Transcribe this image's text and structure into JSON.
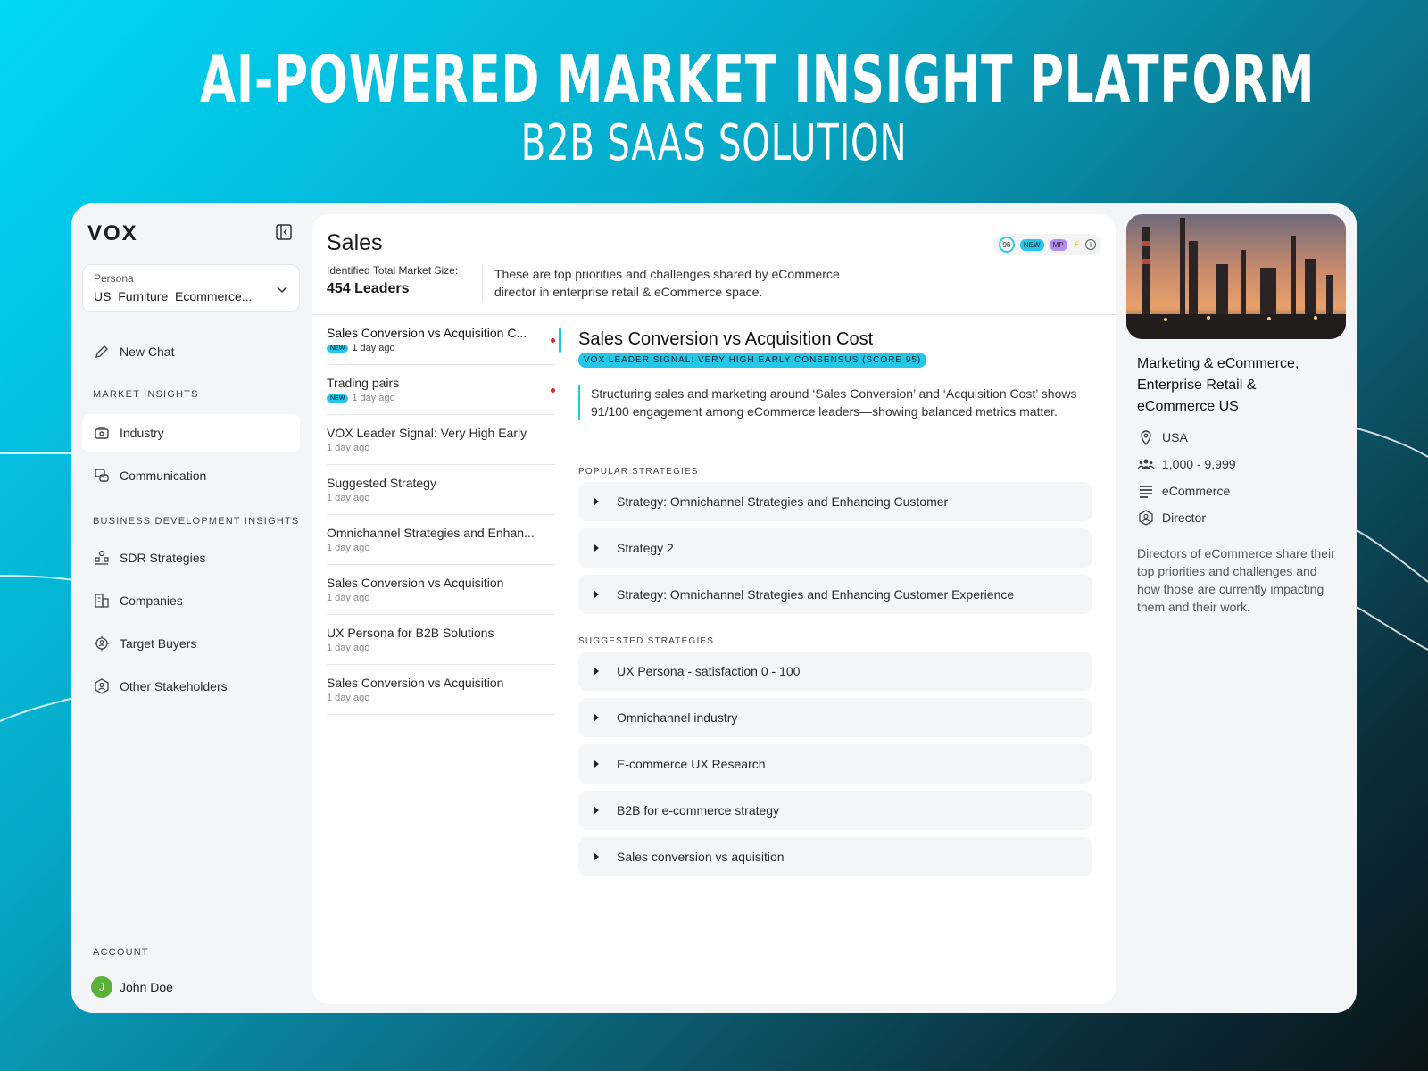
{
  "hero": {
    "title": "AI-POWERED MARKET INSIGHT PLATFORM",
    "subtitle": "B2B SAAS SOLUTION"
  },
  "sidebar": {
    "logo": "VOX",
    "persona_label": "Persona",
    "persona_value": "US_Furniture_Ecommerce...",
    "new_chat": "New Chat",
    "market_insights_label": "MARKET INSIGHTS",
    "market_items": [
      {
        "label": "Industry",
        "icon": "industry-icon",
        "active": true
      },
      {
        "label": "Communication",
        "icon": "communication-icon",
        "active": false
      }
    ],
    "bd_label": "BUSINESS DEVELOPMENT INSIGHTS",
    "bd_items": [
      {
        "label": "SDR Strategies",
        "icon": "sdr-icon"
      },
      {
        "label": "Companies",
        "icon": "companies-icon"
      },
      {
        "label": "Target Buyers",
        "icon": "target-icon"
      },
      {
        "label": "Other Stakeholders",
        "icon": "stakeholders-icon"
      }
    ],
    "account_label": "ACCOUNT",
    "user_initial": "J",
    "user_name": "John Doe",
    "avatar_color": "#5ab038"
  },
  "main": {
    "title": "Sales",
    "badges": {
      "score": "96",
      "new": "NEW",
      "mp": "MP"
    },
    "market_size_label": "Identified Total Market Size:",
    "market_size_value": "454 Leaders",
    "description": "These are top priorities and challenges shared by eCommerce director in enterprise retail & eCommerce space.",
    "list": [
      {
        "title": "Sales Conversion vs Acquisition C...",
        "new": "NEW",
        "time": "1 day ago",
        "dot": true,
        "selected": true
      },
      {
        "title": "Trading pairs",
        "new": "NEW",
        "time": "1 day ago",
        "dot": true,
        "selected": false
      },
      {
        "title": "VOX Leader Signal: Very High Early",
        "time": "1 day ago"
      },
      {
        "title": "Suggested Strategy",
        "time": "1 day ago"
      },
      {
        "title": "Omnichannel Strategies and Enhan...",
        "time": "1 day ago"
      },
      {
        "title": "Sales Conversion vs Acquisition",
        "time": "1 day ago"
      },
      {
        "title": "UX Persona for B2B Solutions",
        "time": "1 day ago"
      },
      {
        "title": "Sales Conversion vs Acquisition",
        "time": "1 day ago"
      }
    ],
    "detail": {
      "title": "Sales Conversion vs Acquisition Cost",
      "signal": "VOX LEADER SIGNAL: VERY HIGH EARLY CONSENSUS (SCORE 95)",
      "quote": "Structuring sales and marketing around ‘Sales Conversion’ and ‘Acquisition Cost’ shows 91/100 engagement among eCommerce leaders—showing balanced metrics matter.",
      "popular_label": "POPULAR STRATEGIES",
      "popular": [
        "Strategy: Omnichannel Strategies and Enhancing Customer",
        "Strategy 2",
        "Strategy: Omnichannel Strategies and Enhancing Customer Experience"
      ],
      "suggested_label": "SUGGESTED STRATEGIES",
      "suggested": [
        "UX Persona - satisfaction 0 - 100",
        "Omnichannel industry",
        "E-commerce UX Research",
        "B2B for e-commerce strategy",
        "Sales conversion vs aquisition"
      ]
    }
  },
  "right": {
    "title": "Marketing & eCommerce, Enterprise Retail & eCommerce US",
    "location": "USA",
    "employees": "1,000 - 9,999",
    "industry": "eCommerce",
    "role": "Director",
    "description": "Directors of eCommerce share their top priorities and challenges and how those are currently impacting them and their work."
  },
  "colors": {
    "accent": "#24c8e6",
    "dot": "#d62a2a",
    "mp": "#b58cf0"
  }
}
